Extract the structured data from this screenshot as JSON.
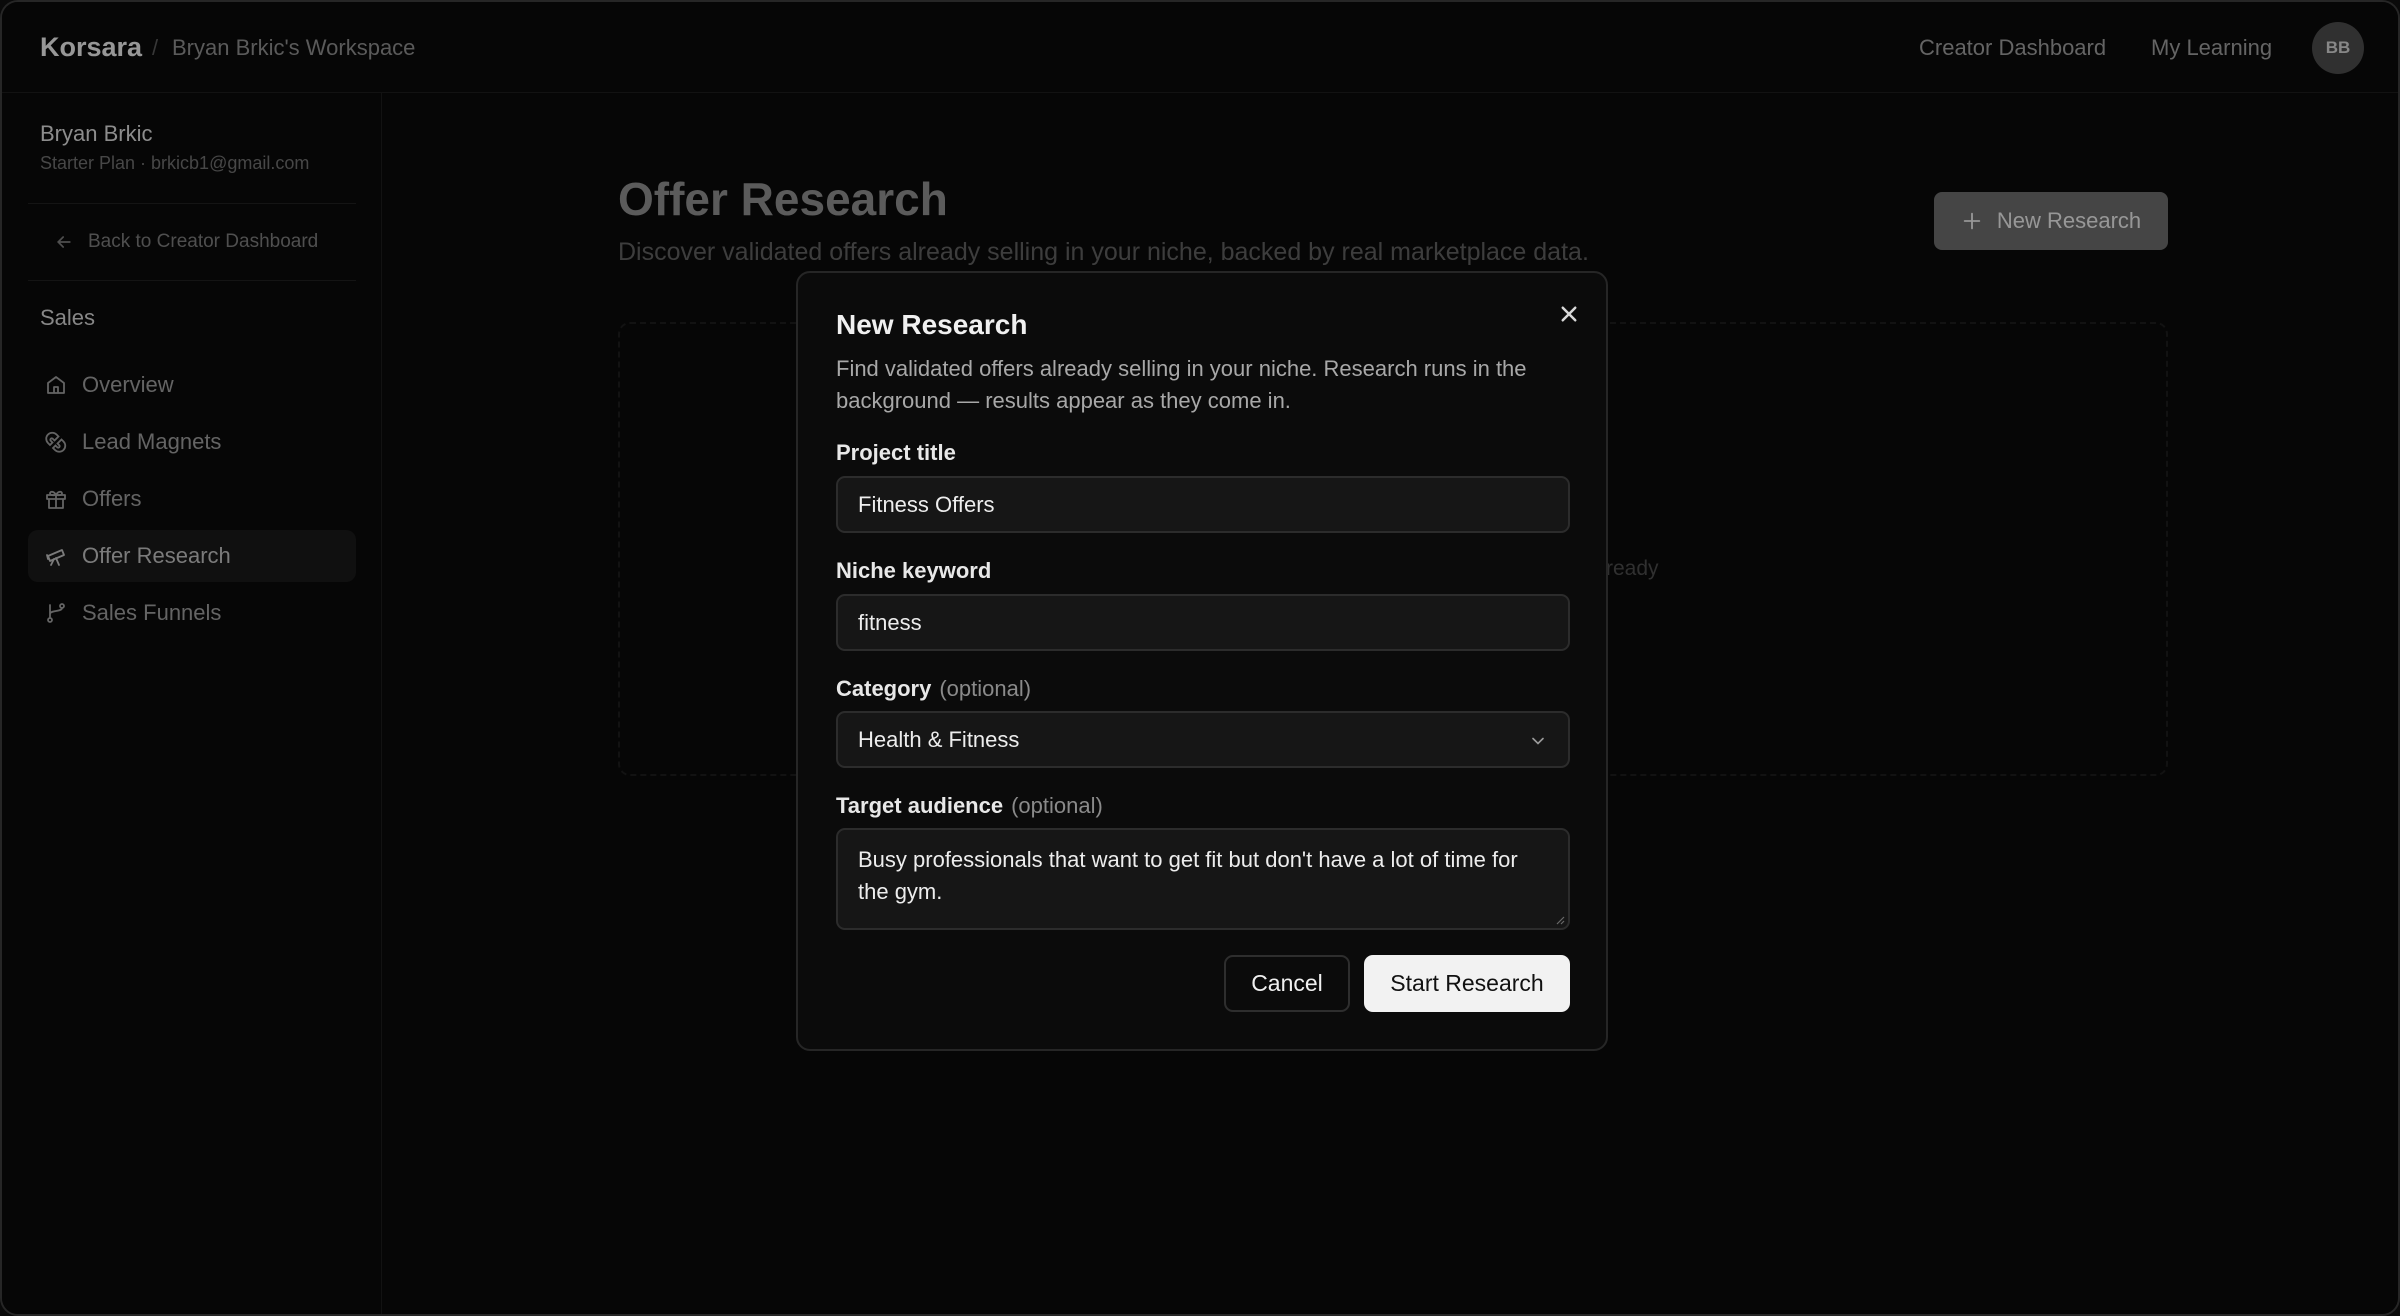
{
  "topbar": {
    "brand": "Korsara",
    "separator": "/",
    "workspace": "Bryan Brkic's Workspace",
    "links": [
      "Creator Dashboard",
      "My Learning"
    ],
    "avatar_initials": "BB"
  },
  "sidebar": {
    "user_name": "Bryan Brkic",
    "user_plan": "Starter Plan · brkicb1@gmail.com",
    "back_label": "Back to Creator Dashboard",
    "section_label": "Sales",
    "items": [
      {
        "label": "Overview",
        "icon": "home-icon"
      },
      {
        "label": "Lead Magnets",
        "icon": "magnet-icon"
      },
      {
        "label": "Offers",
        "icon": "gift-icon"
      },
      {
        "label": "Offer Research",
        "icon": "telescope-icon",
        "active": true
      },
      {
        "label": "Sales Funnels",
        "icon": "git-branch-icon"
      }
    ]
  },
  "main": {
    "title": "Offer Research",
    "subtitle": "Discover validated offers already selling in your niche, backed by real marketplace data.",
    "new_research_label": "New Research",
    "empty_text_fragment": "ready"
  },
  "modal": {
    "title": "New Research",
    "description": "Find validated offers already selling in your niche. Research runs in the background — results appear as they come in.",
    "fields": {
      "project_title": {
        "label": "Project title",
        "value": "Fitness Offers"
      },
      "niche_keyword": {
        "label": "Niche keyword",
        "value": "fitness"
      },
      "category": {
        "label": "Category",
        "optional": "(optional)",
        "value": "Health & Fitness"
      },
      "target_audience": {
        "label": "Target audience",
        "optional": "(optional)",
        "value": "Busy professionals that want to get fit but don't have a lot of time for the gym."
      }
    },
    "cancel_label": "Cancel",
    "start_label": "Start Research"
  },
  "colors": {
    "background": "#0a0a0a",
    "modal_bg": "#0b0b0b",
    "primary_button": "#f2f2f2",
    "input_bg": "#161616"
  }
}
